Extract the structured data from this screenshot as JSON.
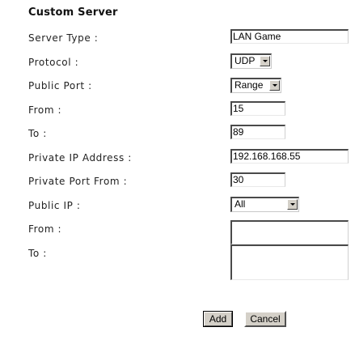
{
  "form": {
    "title": "Custom Server",
    "labels": {
      "server_type": "Server Type :",
      "protocol": "Protocol :",
      "public_port": "Public Port :",
      "from": "From :",
      "to": "To :",
      "private_ip": "Private IP Address :",
      "private_port_from": "Private Port From :",
      "public_ip": "Public IP :",
      "from2": "From :",
      "to2": "To :"
    },
    "values": {
      "server_type": "LAN Game",
      "protocol": "UDP",
      "public_port": "Range",
      "from": "15",
      "to": "89",
      "private_ip": "192.168.168.55",
      "private_port_from": "30",
      "public_ip": "All",
      "from2": "",
      "to2": ""
    },
    "buttons": {
      "add": "Add",
      "cancel": "Cancel"
    }
  }
}
